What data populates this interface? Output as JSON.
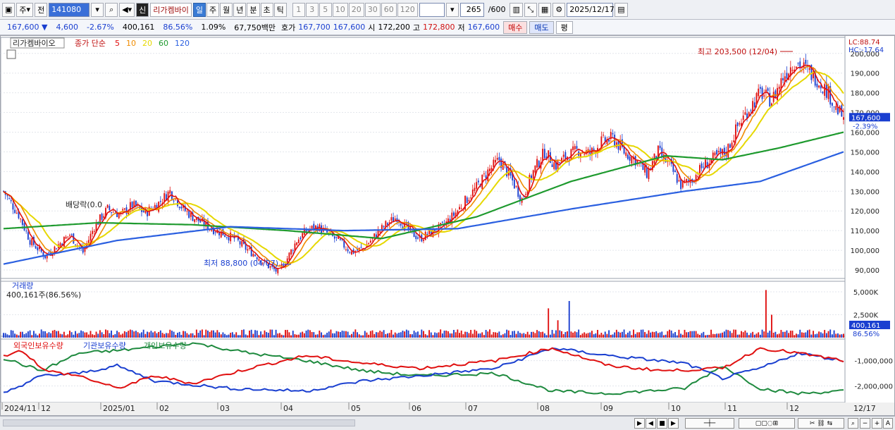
{
  "toolbar": {
    "market": "주",
    "prev": "전",
    "code": "141080",
    "name": "리가켐바이",
    "badge": "신",
    "periods": [
      "일",
      "주",
      "월",
      "년",
      "분",
      "초",
      "틱"
    ],
    "active_period": "일",
    "intervals": [
      "1",
      "3",
      "5",
      "10",
      "20",
      "30",
      "60",
      "120"
    ],
    "count": "265",
    "count_total": "/600",
    "date": "2025/12/17"
  },
  "quote": {
    "price": "167,600",
    "change": "4,600",
    "change_pct": "-2.67%",
    "volume": "400,161",
    "vol_ratio": "86.56%",
    "turnover_pct": "1.09%",
    "amount": "67,750백만",
    "ask_label": "호가",
    "ask1": "167,700",
    "bid1": "167,600",
    "open_label": "시",
    "open": "172,200",
    "high_label": "고",
    "high": "172,800",
    "low_label": "저",
    "low": "167,600",
    "buy_label": "매수",
    "sell_label": "매도",
    "avg_label": "평"
  },
  "chart_data": [
    {
      "type": "candlestick",
      "title": "리가켐바이오",
      "ma_legend": "종가 단순",
      "ma_periods": [
        5,
        10,
        20,
        60,
        120
      ],
      "ma_colors": [
        "#e01010",
        "#f08c00",
        "#e6d800",
        "#1e9a2e",
        "#2a5fe0"
      ],
      "up_color": "#e01010",
      "down_color": "#1a3fd0",
      "ylim": [
        85000,
        206000
      ],
      "yticks": [
        "90,000",
        "100,000",
        "110,000",
        "120,000",
        "130,000",
        "140,000",
        "150,000",
        "160,000",
        "170,000",
        "180,000",
        "190,000",
        "200,000"
      ],
      "ytick_values": [
        90000,
        100000,
        110000,
        120000,
        130000,
        140000,
        150000,
        160000,
        170000,
        180000,
        190000,
        200000
      ],
      "last_price": "167,600",
      "last_change": "-2.39%",
      "lc": "LC:88.74",
      "hc": "HC:-17.64",
      "max_annotation": "최고 203,500 (12/04)",
      "min_annotation": "최저 88,800 (04/07)",
      "dividend_annotation": "배당락(0.0",
      "x_labels": [
        "2024/11",
        "12",
        "2025/01",
        "02",
        "03",
        "04",
        "05",
        "06",
        "07",
        "08",
        "09",
        "10",
        "11",
        "12"
      ],
      "x_end_label": "12/17",
      "price_path": [
        [
          0,
          130000
        ],
        [
          8,
          118000
        ],
        [
          14,
          105000
        ],
        [
          22,
          97000
        ],
        [
          28,
          102000
        ],
        [
          35,
          108000
        ],
        [
          42,
          99000
        ],
        [
          48,
          112000
        ],
        [
          55,
          121000
        ],
        [
          62,
          118000
        ],
        [
          68,
          123000
        ],
        [
          75,
          119000
        ],
        [
          82,
          124000
        ],
        [
          88,
          130000
        ],
        [
          95,
          121000
        ],
        [
          100,
          117000
        ],
        [
          108,
          112000
        ],
        [
          115,
          109000
        ],
        [
          122,
          106000
        ],
        [
          128,
          101000
        ],
        [
          134,
          97000
        ],
        [
          140,
          92000
        ],
        [
          145,
          89000
        ],
        [
          150,
          96000
        ],
        [
          155,
          105000
        ],
        [
          160,
          110000
        ],
        [
          166,
          112000
        ],
        [
          172,
          108000
        ],
        [
          178,
          104000
        ],
        [
          184,
          99000
        ],
        [
          190,
          101000
        ],
        [
          196,
          107000
        ],
        [
          202,
          113000
        ],
        [
          208,
          117000
        ],
        [
          214,
          110000
        ],
        [
          220,
          106000
        ],
        [
          226,
          109000
        ],
        [
          232,
          112000
        ],
        [
          238,
          118000
        ],
        [
          244,
          125000
        ],
        [
          250,
          132000
        ],
        [
          256,
          140000
        ],
        [
          262,
          146000
        ],
        [
          268,
          137000
        ],
        [
          274,
          126000
        ],
        [
          280,
          140000
        ],
        [
          286,
          150000
        ],
        [
          292,
          143000
        ],
        [
          298,
          148000
        ],
        [
          304,
          151000
        ],
        [
          310,
          149000
        ],
        [
          316,
          155000
        ],
        [
          322,
          157000
        ],
        [
          328,
          150000
        ],
        [
          334,
          146000
        ],
        [
          340,
          139000
        ],
        [
          346,
          150000
        ],
        [
          352,
          143000
        ],
        [
          358,
          133000
        ],
        [
          364,
          136000
        ],
        [
          370,
          143000
        ],
        [
          376,
          147000
        ],
        [
          382,
          150000
        ],
        [
          388,
          163000
        ],
        [
          394,
          172000
        ],
        [
          400,
          180000
        ],
        [
          406,
          176000
        ],
        [
          412,
          188000
        ],
        [
          418,
          196000
        ],
        [
          424,
          192000
        ],
        [
          430,
          187000
        ],
        [
          436,
          180000
        ],
        [
          440,
          172000
        ],
        [
          444,
          167600
        ]
      ],
      "ma60": [
        [
          0,
          111000
        ],
        [
          50,
          114000
        ],
        [
          100,
          113000
        ],
        [
          150,
          110000
        ],
        [
          200,
          106000
        ],
        [
          250,
          117000
        ],
        [
          300,
          135000
        ],
        [
          350,
          148000
        ],
        [
          380,
          146000
        ],
        [
          410,
          152000
        ],
        [
          444,
          160000
        ]
      ],
      "ma120": [
        [
          0,
          93000
        ],
        [
          60,
          105000
        ],
        [
          120,
          112000
        ],
        [
          180,
          110000
        ],
        [
          240,
          111000
        ],
        [
          300,
          121000
        ],
        [
          360,
          130000
        ],
        [
          400,
          135000
        ],
        [
          444,
          150000
        ]
      ],
      "volume": {
        "label": "거래량",
        "current": "400,161주(86.56%)",
        "yticks": [
          "2,500K",
          "5,000K"
        ],
        "ytick_values": [
          2500000,
          5000000
        ],
        "last_value": "400,161",
        "last_pct": "86.56%",
        "ymax": 6000000,
        "spikes": [
          [
            288,
            3200000
          ],
          [
            299,
            4000000
          ],
          [
            403,
            5200000
          ],
          [
            406,
            2500000
          ],
          [
            293,
            1900000
          ]
        ]
      },
      "holdings": {
        "series": [
          {
            "name": "외국인보유수량",
            "color": "#e01010"
          },
          {
            "name": "기관보유수량",
            "color": "#1a3fd0"
          },
          {
            "name": "개인보유수량",
            "color": "#1e8a3e"
          }
        ],
        "yticks": [
          "-1,000,000",
          "-2,000,000"
        ],
        "ytick_values": [
          -1000000,
          -2000000
        ],
        "foreign": [
          [
            0,
            -800000
          ],
          [
            10,
            -600000
          ],
          [
            22,
            -1400000
          ],
          [
            40,
            -1600000
          ],
          [
            60,
            -2100000
          ],
          [
            80,
            -1600000
          ],
          [
            100,
            -1900000
          ],
          [
            130,
            -1300000
          ],
          [
            160,
            -800000
          ],
          [
            190,
            -1100000
          ],
          [
            220,
            -1300000
          ],
          [
            260,
            -1000000
          ],
          [
            290,
            -500000
          ],
          [
            320,
            -1200000
          ],
          [
            350,
            -1400000
          ],
          [
            380,
            -1300000
          ],
          [
            400,
            -500000
          ],
          [
            420,
            -700000
          ],
          [
            444,
            -1000000
          ]
        ],
        "institution": [
          [
            0,
            -2300000
          ],
          [
            20,
            -1600000
          ],
          [
            40,
            -1500000
          ],
          [
            60,
            -1200000
          ],
          [
            80,
            -1800000
          ],
          [
            120,
            -2100000
          ],
          [
            160,
            -2200000
          ],
          [
            190,
            -1800000
          ],
          [
            220,
            -1600000
          ],
          [
            260,
            -1300000
          ],
          [
            290,
            -500000
          ],
          [
            320,
            -800000
          ],
          [
            360,
            -1100000
          ],
          [
            380,
            -1700000
          ],
          [
            400,
            -1300000
          ],
          [
            420,
            -700000
          ],
          [
            444,
            -1000000
          ]
        ],
        "individual": [
          [
            0,
            -900000
          ],
          [
            20,
            -1400000
          ],
          [
            40,
            -700000
          ],
          [
            60,
            -600000
          ],
          [
            100,
            -300000
          ],
          [
            130,
            -700000
          ],
          [
            160,
            -1000000
          ],
          [
            190,
            -1400000
          ],
          [
            220,
            -1600000
          ],
          [
            260,
            -1500000
          ],
          [
            290,
            -2200000
          ],
          [
            320,
            -2300000
          ],
          [
            360,
            -2100000
          ],
          [
            380,
            -1200000
          ],
          [
            400,
            -2100000
          ],
          [
            420,
            -2300000
          ],
          [
            444,
            -2200000
          ]
        ]
      }
    }
  ]
}
